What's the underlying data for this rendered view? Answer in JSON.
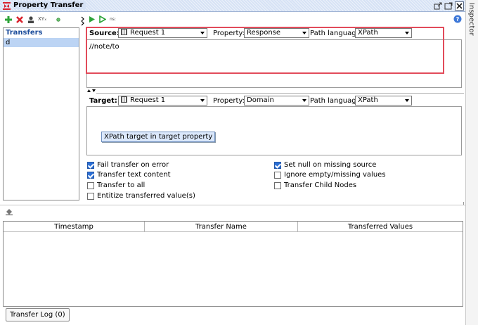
{
  "window": {
    "title": "Property Transfer",
    "inspector_label": "Inspector"
  },
  "left_toolbar": {
    "xpath_hint": "XYₓ",
    "label_small": "ns:"
  },
  "transfers": {
    "header": "Transfers",
    "items": [
      "d"
    ]
  },
  "source": {
    "label": "Source:",
    "request": "Request 1",
    "property_label": "Property:",
    "property": "Response",
    "path_language_label": "Path language:",
    "path_language": "XPath",
    "expression": "//note/to"
  },
  "target": {
    "label": "Target:",
    "request": "Request 1",
    "property_label": "Property:",
    "property": "Domain",
    "path_language_label": "Path language:",
    "path_language": "XPath",
    "tooltip": "XPath target in target property"
  },
  "options": {
    "fail_transfer_on_error": {
      "label": "Fail transfer on error",
      "checked": true
    },
    "transfer_text_content": {
      "label": "Transfer text content",
      "checked": true
    },
    "transfer_to_all": {
      "label": "Transfer to all",
      "checked": false
    },
    "entitize": {
      "label": "Entitize transferred value(s)",
      "checked": false
    },
    "set_null": {
      "label": "Set null on missing source",
      "checked": true
    },
    "ignore_empty": {
      "label": "Ignore empty/missing values",
      "checked": false
    },
    "transfer_child_nodes": {
      "label": "Transfer Child Nodes",
      "checked": false
    }
  },
  "log": {
    "columns": [
      "Timestamp",
      "Transfer Name",
      "Transferred Values"
    ],
    "tab_label": "Transfer Log (0)"
  },
  "colors": {
    "accent_green": "#2ea43a",
    "delete_red": "#d9232e",
    "highlight_red": "#e24b5a",
    "list_selected": "#bcd4f4",
    "header_blue": "#1d4e9c"
  }
}
